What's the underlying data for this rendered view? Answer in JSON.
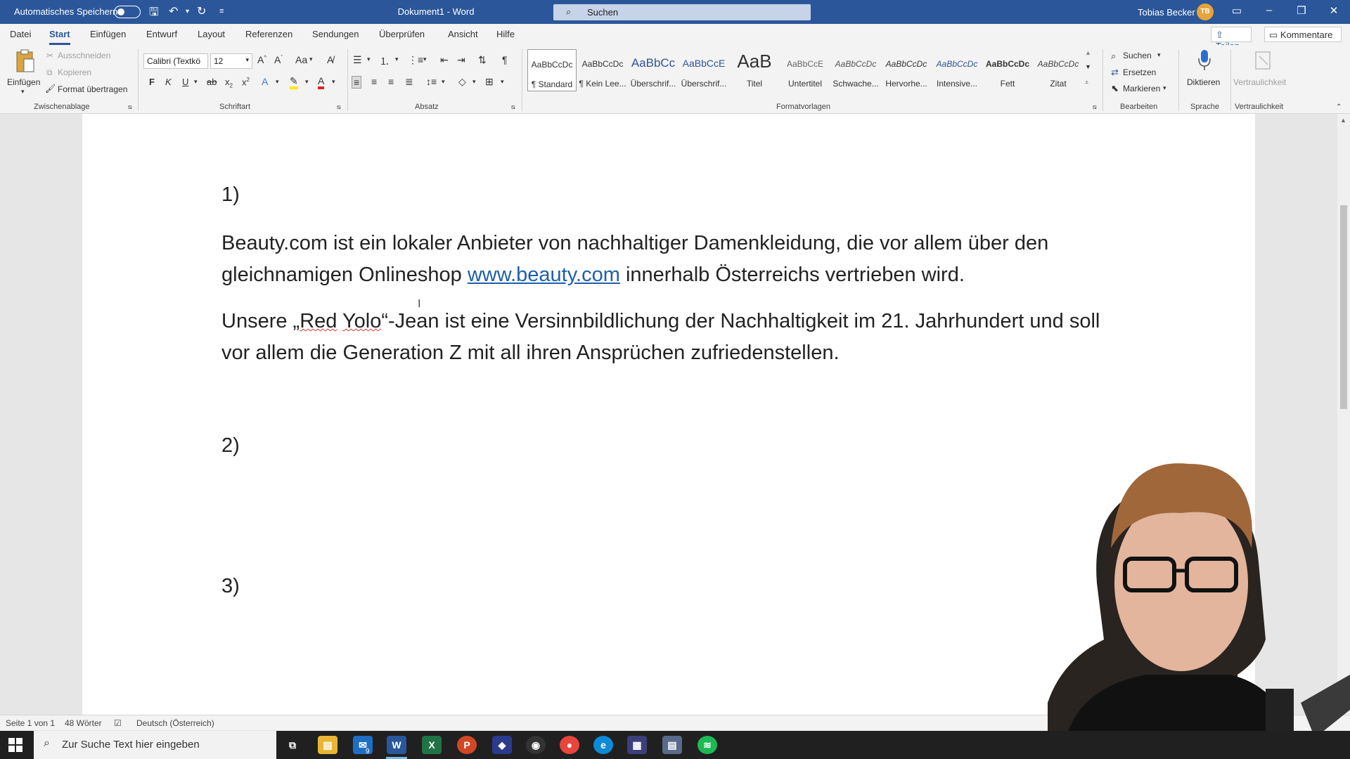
{
  "titlebar": {
    "autosave_label": "Automatisches Speichern",
    "doc_title": "Dokument1 - Word",
    "search_placeholder": "Suchen",
    "user_name": "Tobias Becker",
    "user_initials": "TB"
  },
  "menu": {
    "tabs": [
      "Datei",
      "Start",
      "Einfügen",
      "Entwurf",
      "Layout",
      "Referenzen",
      "Sendungen",
      "Überprüfen",
      "Ansicht",
      "Hilfe"
    ],
    "active_tab": "Start",
    "share_label": "Teilen",
    "comments_label": "Kommentare"
  },
  "ribbon": {
    "clipboard": {
      "paste": "Einfügen",
      "cut": "Ausschneiden",
      "copy": "Kopieren",
      "format_painter": "Format übertragen",
      "group": "Zwischenablage"
    },
    "font": {
      "font_name": "Calibri (Textkö",
      "font_size": "12",
      "bold": "F",
      "italic": "K",
      "underline": "U",
      "change_case": "Aa",
      "group": "Schriftart"
    },
    "paragraph": {
      "group": "Absatz"
    },
    "styles": {
      "items": [
        {
          "preview": "AaBbCcDc",
          "name": "¶ Standard"
        },
        {
          "preview": "AaBbCcDc",
          "name": "¶ Kein Lee..."
        },
        {
          "preview": "AaBbCc",
          "name": "Überschrif..."
        },
        {
          "preview": "AaBbCcE",
          "name": "Überschrif..."
        },
        {
          "preview": "AaB",
          "name": "Titel"
        },
        {
          "preview": "AaBbCcE",
          "name": "Untertitel"
        },
        {
          "preview": "AaBbCcDc",
          "name": "Schwache..."
        },
        {
          "preview": "AaBbCcDc",
          "name": "Hervorhe..."
        },
        {
          "preview": "AaBbCcDc",
          "name": "Intensive..."
        },
        {
          "preview": "AaBbCcDc",
          "name": "Fett"
        },
        {
          "preview": "AaBbCcDc",
          "name": "Zitat"
        }
      ],
      "group": "Formatvorlagen"
    },
    "editing": {
      "find": "Suchen",
      "replace": "Ersetzen",
      "select": "Markieren",
      "group": "Bearbeiten"
    },
    "voice": {
      "dictate": "Diktieren",
      "group": "Sprache"
    },
    "sensitivity": {
      "label": "Vertraulichkeit",
      "group": "Vertraulichkeit"
    }
  },
  "document": {
    "heading1": "1)",
    "para1_part1": "Beauty.com ist ein lokaler Anbieter von nachhaltiger Damenkleidung, die vor allem über den gleichnamigen Onlineshop ",
    "para1_link": "www.beauty.com",
    "para1_part2": " innerhalb Österreichs vertrieben wird.",
    "para2_part1": "Unsere „",
    "para2_red": "Red",
    "para2_space": " ",
    "para2_yolo": "Yolo",
    "para2_part2": "“-Jean ist eine Versinnbildlichung der Nachhaltigkeit im 21. Jahrhundert und soll vor allem die Generation Z mit all ihren Ansprüchen zufriedenstellen.",
    "heading2": "2)",
    "heading3": "3)"
  },
  "statusbar": {
    "page": "Seite 1 von 1",
    "words": "48 Wörter",
    "language": "Deutsch (Österreich)"
  },
  "taskbar": {
    "search_placeholder": "Zur Suche Text hier eingeben",
    "mail_badge": "9"
  },
  "colors": {
    "accent": "#2b579a",
    "link": "#1f5fa8"
  }
}
